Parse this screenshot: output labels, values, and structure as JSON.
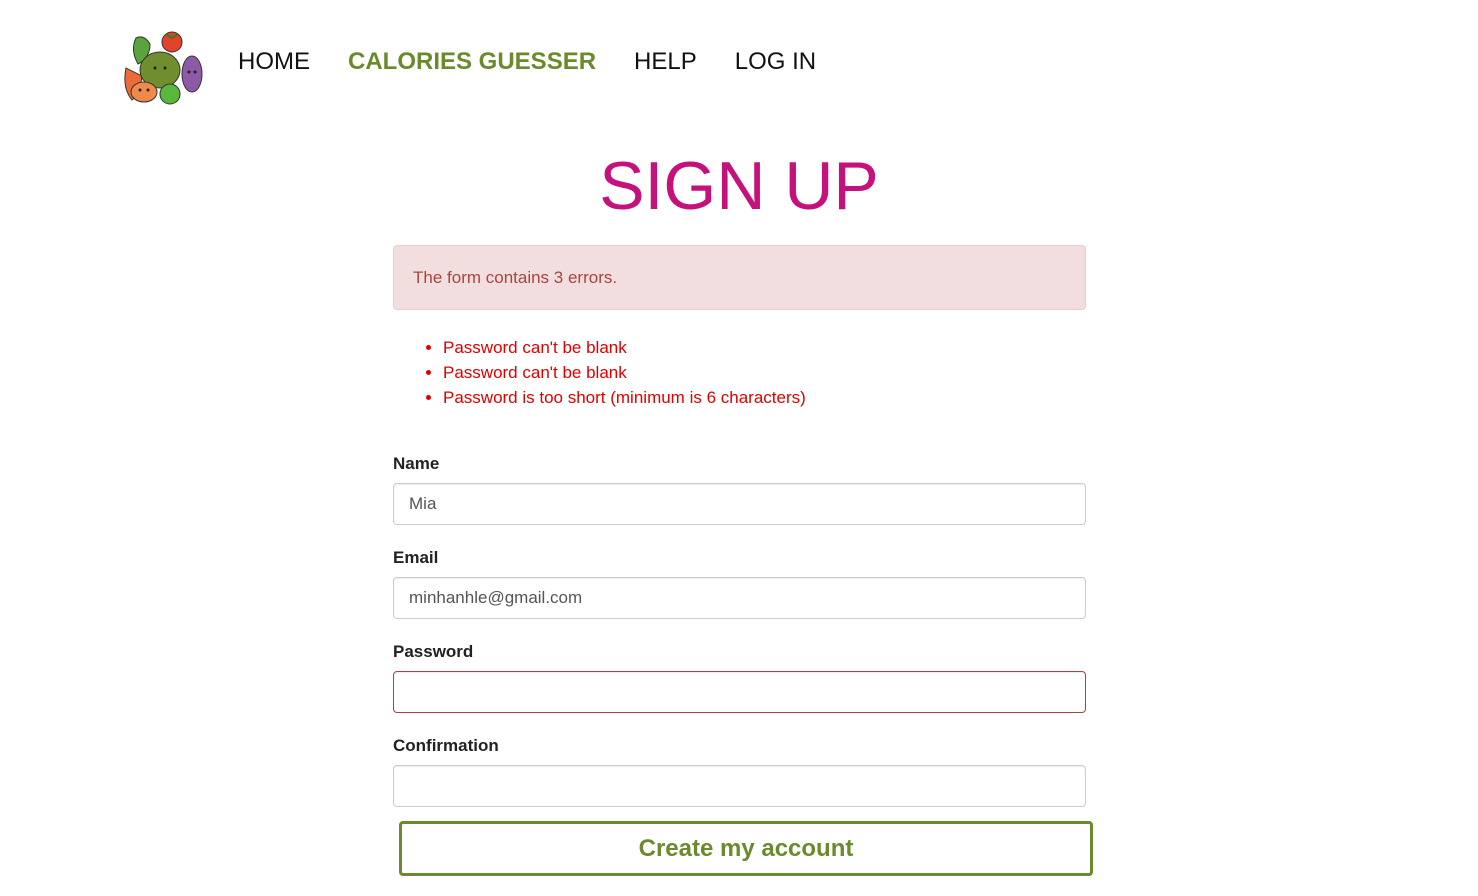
{
  "header": {
    "logo_alt": "vegetables logo",
    "nav": [
      {
        "label": "HOME",
        "active": false
      },
      {
        "label": "CALORIES GUESSER",
        "active": true
      },
      {
        "label": "HELP",
        "active": false
      },
      {
        "label": "LOG IN",
        "active": false
      }
    ]
  },
  "page": {
    "title": "SIGN UP"
  },
  "alert": {
    "message": "The form contains 3 errors."
  },
  "errors": [
    "Password can't be blank",
    "Password can't be blank",
    "Password is too short (minimum is 6 characters)"
  ],
  "form": {
    "name": {
      "label": "Name",
      "value": "Mia"
    },
    "email": {
      "label": "Email",
      "value": "minhanhle@gmail.com"
    },
    "password": {
      "label": "Password",
      "value": ""
    },
    "confirmation": {
      "label": "Confirmation",
      "value": ""
    },
    "submit_label": "Create my account"
  },
  "colors": {
    "accent_green": "#6b8a2b",
    "title_magenta": "#c4117b",
    "error_red": "#e00000",
    "alert_bg": "#f2dede"
  }
}
